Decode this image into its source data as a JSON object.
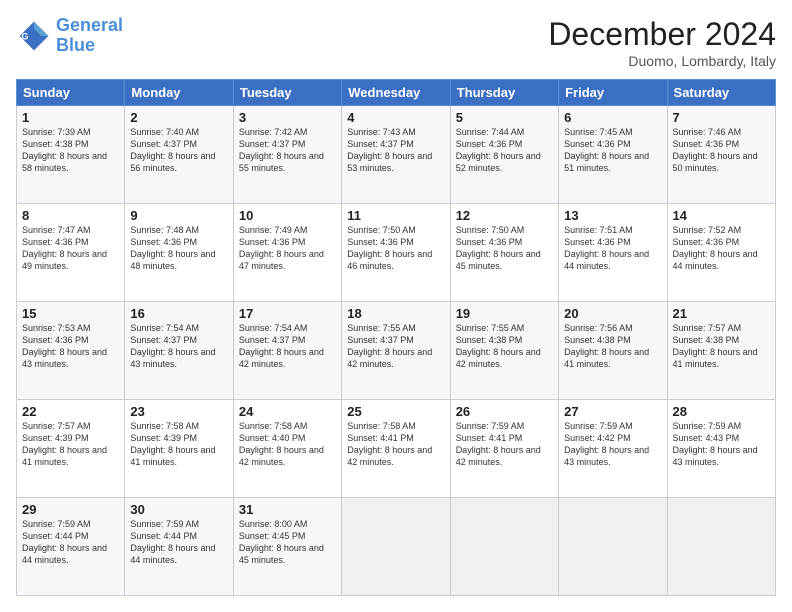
{
  "header": {
    "logo_line1": "General",
    "logo_line2": "Blue",
    "month": "December 2024",
    "location": "Duomo, Lombardy, Italy"
  },
  "weekdays": [
    "Sunday",
    "Monday",
    "Tuesday",
    "Wednesday",
    "Thursday",
    "Friday",
    "Saturday"
  ],
  "weeks": [
    [
      {
        "day": "1",
        "sunrise": "7:39 AM",
        "sunset": "4:38 PM",
        "daylight": "8 hours and 58 minutes."
      },
      {
        "day": "2",
        "sunrise": "7:40 AM",
        "sunset": "4:37 PM",
        "daylight": "8 hours and 56 minutes."
      },
      {
        "day": "3",
        "sunrise": "7:42 AM",
        "sunset": "4:37 PM",
        "daylight": "8 hours and 55 minutes."
      },
      {
        "day": "4",
        "sunrise": "7:43 AM",
        "sunset": "4:37 PM",
        "daylight": "8 hours and 53 minutes."
      },
      {
        "day": "5",
        "sunrise": "7:44 AM",
        "sunset": "4:36 PM",
        "daylight": "8 hours and 52 minutes."
      },
      {
        "day": "6",
        "sunrise": "7:45 AM",
        "sunset": "4:36 PM",
        "daylight": "8 hours and 51 minutes."
      },
      {
        "day": "7",
        "sunrise": "7:46 AM",
        "sunset": "4:36 PM",
        "daylight": "8 hours and 50 minutes."
      }
    ],
    [
      {
        "day": "8",
        "sunrise": "7:47 AM",
        "sunset": "4:36 PM",
        "daylight": "8 hours and 49 minutes."
      },
      {
        "day": "9",
        "sunrise": "7:48 AM",
        "sunset": "4:36 PM",
        "daylight": "8 hours and 48 minutes."
      },
      {
        "day": "10",
        "sunrise": "7:49 AM",
        "sunset": "4:36 PM",
        "daylight": "8 hours and 47 minutes."
      },
      {
        "day": "11",
        "sunrise": "7:50 AM",
        "sunset": "4:36 PM",
        "daylight": "8 hours and 46 minutes."
      },
      {
        "day": "12",
        "sunrise": "7:50 AM",
        "sunset": "4:36 PM",
        "daylight": "8 hours and 45 minutes."
      },
      {
        "day": "13",
        "sunrise": "7:51 AM",
        "sunset": "4:36 PM",
        "daylight": "8 hours and 44 minutes."
      },
      {
        "day": "14",
        "sunrise": "7:52 AM",
        "sunset": "4:36 PM",
        "daylight": "8 hours and 44 minutes."
      }
    ],
    [
      {
        "day": "15",
        "sunrise": "7:53 AM",
        "sunset": "4:36 PM",
        "daylight": "8 hours and 43 minutes."
      },
      {
        "day": "16",
        "sunrise": "7:54 AM",
        "sunset": "4:37 PM",
        "daylight": "8 hours and 43 minutes."
      },
      {
        "day": "17",
        "sunrise": "7:54 AM",
        "sunset": "4:37 PM",
        "daylight": "8 hours and 42 minutes."
      },
      {
        "day": "18",
        "sunrise": "7:55 AM",
        "sunset": "4:37 PM",
        "daylight": "8 hours and 42 minutes."
      },
      {
        "day": "19",
        "sunrise": "7:55 AM",
        "sunset": "4:38 PM",
        "daylight": "8 hours and 42 minutes."
      },
      {
        "day": "20",
        "sunrise": "7:56 AM",
        "sunset": "4:38 PM",
        "daylight": "8 hours and 41 minutes."
      },
      {
        "day": "21",
        "sunrise": "7:57 AM",
        "sunset": "4:38 PM",
        "daylight": "8 hours and 41 minutes."
      }
    ],
    [
      {
        "day": "22",
        "sunrise": "7:57 AM",
        "sunset": "4:39 PM",
        "daylight": "8 hours and 41 minutes."
      },
      {
        "day": "23",
        "sunrise": "7:58 AM",
        "sunset": "4:39 PM",
        "daylight": "8 hours and 41 minutes."
      },
      {
        "day": "24",
        "sunrise": "7:58 AM",
        "sunset": "4:40 PM",
        "daylight": "8 hours and 42 minutes."
      },
      {
        "day": "25",
        "sunrise": "7:58 AM",
        "sunset": "4:41 PM",
        "daylight": "8 hours and 42 minutes."
      },
      {
        "day": "26",
        "sunrise": "7:59 AM",
        "sunset": "4:41 PM",
        "daylight": "8 hours and 42 minutes."
      },
      {
        "day": "27",
        "sunrise": "7:59 AM",
        "sunset": "4:42 PM",
        "daylight": "8 hours and 43 minutes."
      },
      {
        "day": "28",
        "sunrise": "7:59 AM",
        "sunset": "4:43 PM",
        "daylight": "8 hours and 43 minutes."
      }
    ],
    [
      {
        "day": "29",
        "sunrise": "7:59 AM",
        "sunset": "4:44 PM",
        "daylight": "8 hours and 44 minutes."
      },
      {
        "day": "30",
        "sunrise": "7:59 AM",
        "sunset": "4:44 PM",
        "daylight": "8 hours and 44 minutes."
      },
      {
        "day": "31",
        "sunrise": "8:00 AM",
        "sunset": "4:45 PM",
        "daylight": "8 hours and 45 minutes."
      },
      null,
      null,
      null,
      null
    ]
  ]
}
